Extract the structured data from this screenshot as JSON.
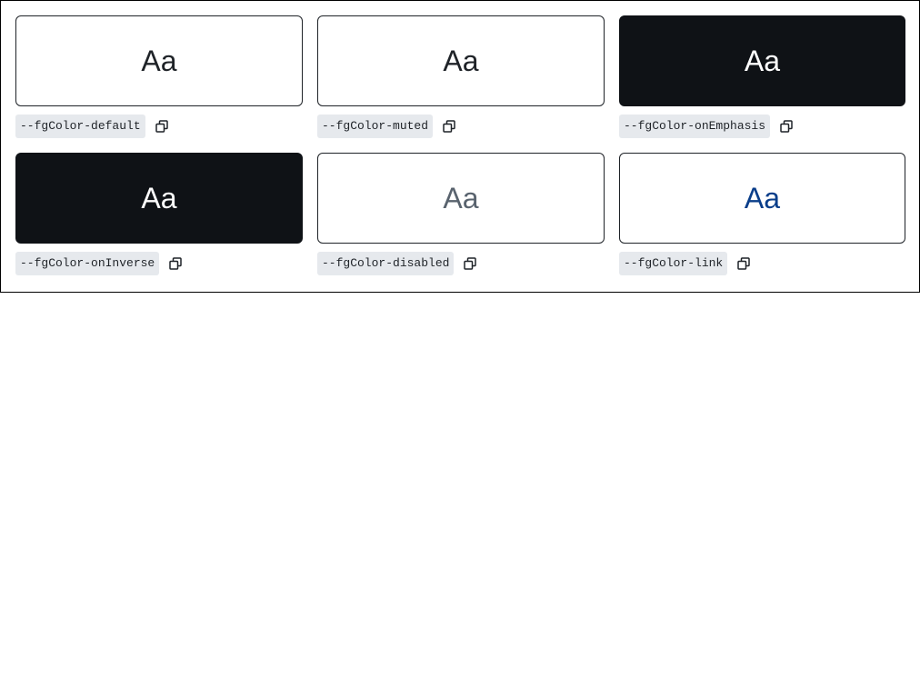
{
  "tokens": [
    {
      "sample": "Aa",
      "name": "--fgColor-default",
      "bg": "#ffffff",
      "fg": "#1f2328",
      "border": "#1f2328"
    },
    {
      "sample": "Aa",
      "name": "--fgColor-muted",
      "bg": "#ffffff",
      "fg": "#1f2328",
      "border": "#1f2328"
    },
    {
      "sample": "Aa",
      "name": "--fgColor-onEmphasis",
      "bg": "#0f1216",
      "fg": "#ffffff",
      "border": "#0f1216"
    },
    {
      "sample": "Aa",
      "name": "--fgColor-onInverse",
      "bg": "#0f1216",
      "fg": "#ffffff",
      "border": "#0f1216"
    },
    {
      "sample": "Aa",
      "name": "--fgColor-disabled",
      "bg": "#ffffff",
      "fg": "#59636e",
      "border": "#1f2328"
    },
    {
      "sample": "Aa",
      "name": "--fgColor-link",
      "bg": "#ffffff",
      "fg": "#0a3e8a",
      "border": "#1f2328"
    }
  ],
  "icons": {
    "copy": "copy-icon"
  }
}
